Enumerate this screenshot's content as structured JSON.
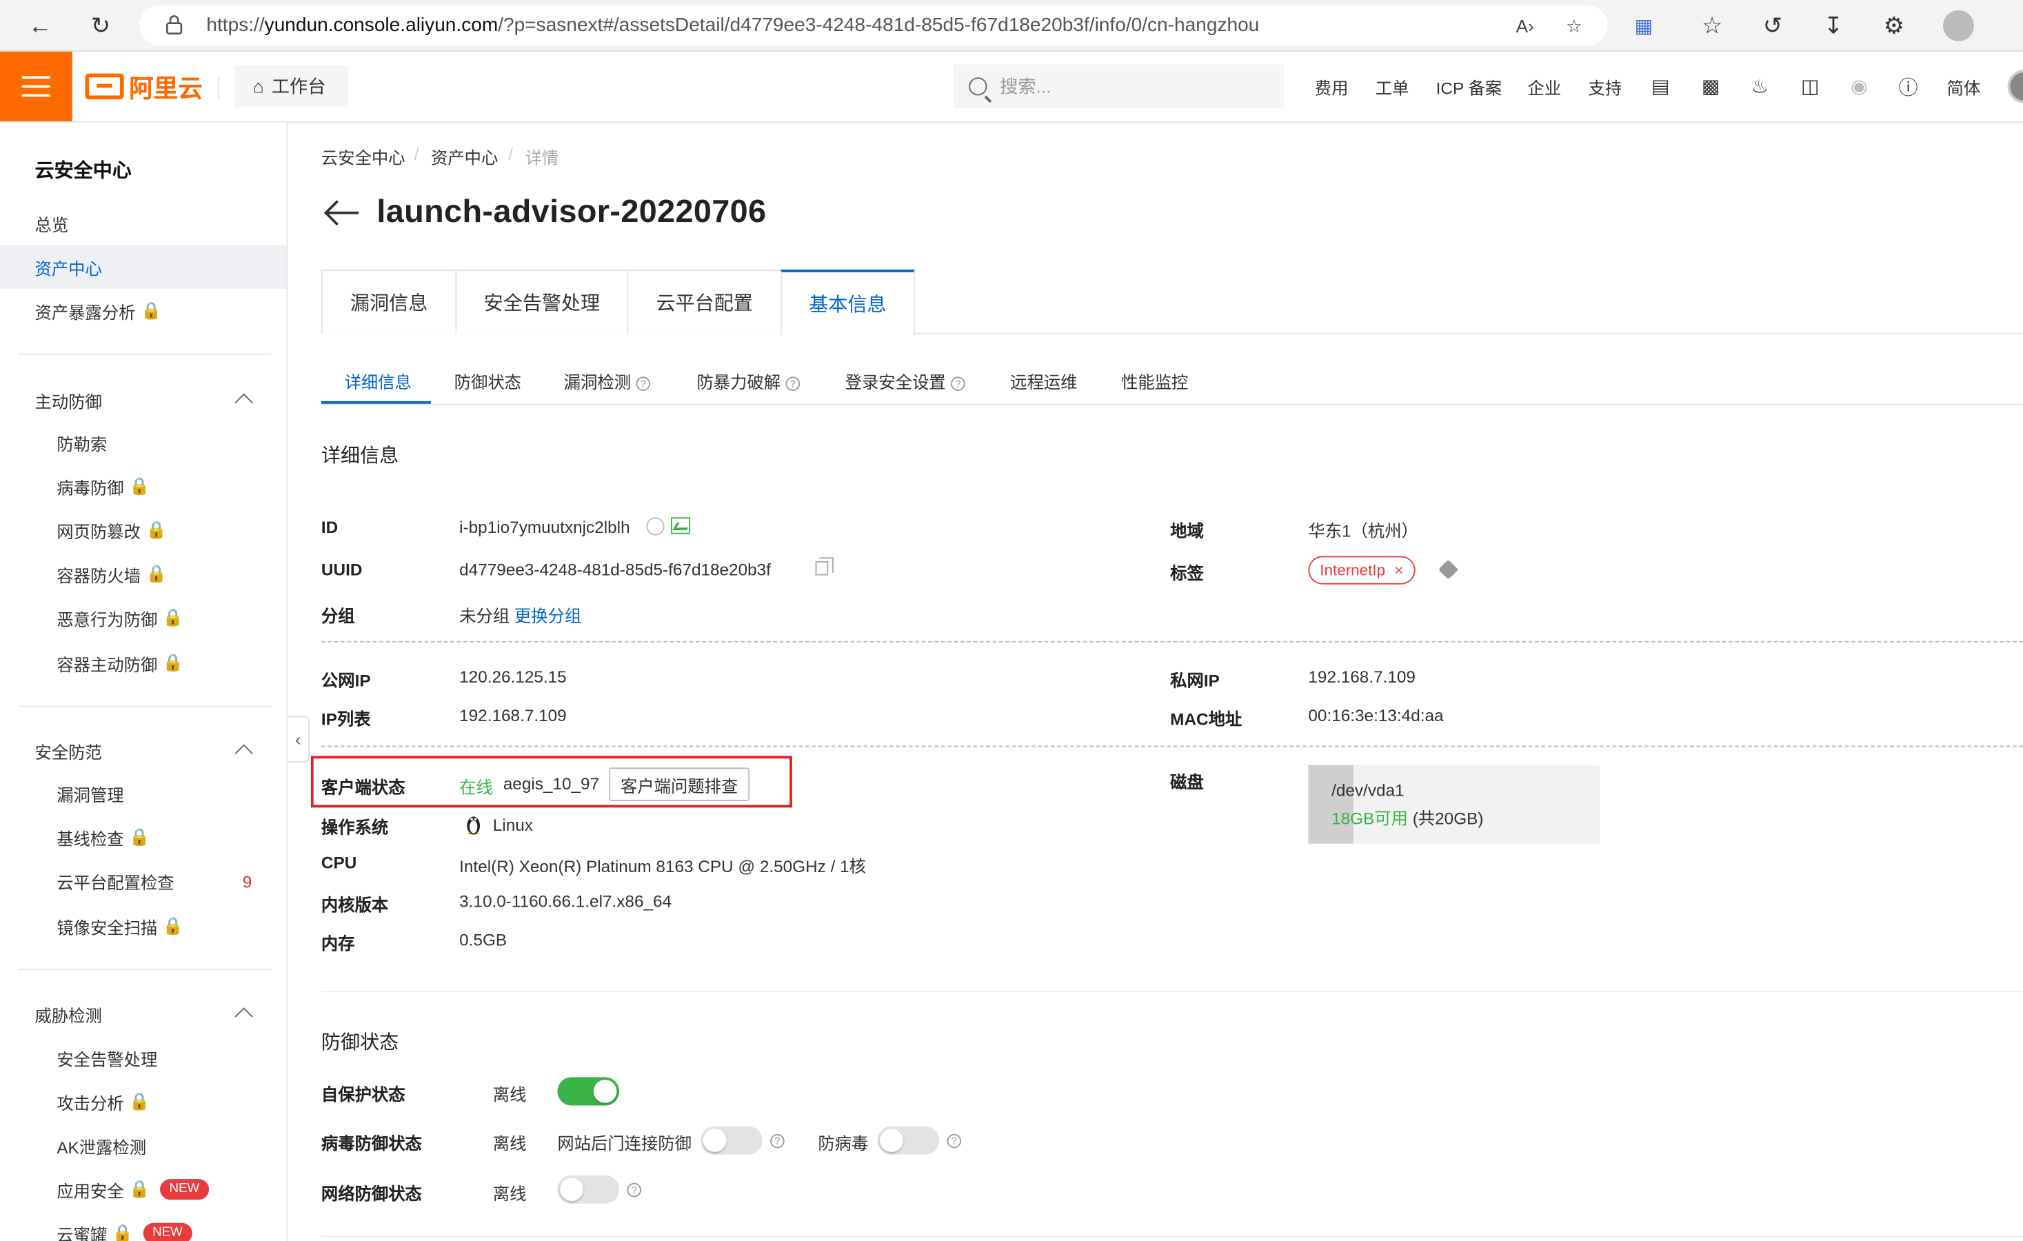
{
  "browser": {
    "url_prefix": "https://",
    "url_host": "yundun.console.aliyun.com",
    "url_path": "/?p=sasnext#/assetsDetail/d4779ee3-4248-481d-85d5-f67d18e20b3f/info/0/cn-hangzhou"
  },
  "topbar": {
    "logo_text": "阿里云",
    "workbench": "工作台",
    "search_placeholder": "搜索...",
    "nav": [
      "费用",
      "工单",
      "ICP 备案",
      "企业",
      "支持"
    ],
    "lang": "简体"
  },
  "sidebar": {
    "title": "云安全中心",
    "items_top": [
      {
        "label": "总览"
      },
      {
        "label": "资产中心",
        "active": true
      },
      {
        "label": "资产暴露分析",
        "locked": true
      }
    ],
    "groups": [
      {
        "title": "主动防御",
        "items": [
          {
            "label": "防勒索"
          },
          {
            "label": "病毒防御",
            "locked": true
          },
          {
            "label": "网页防篡改",
            "locked": true
          },
          {
            "label": "容器防火墙",
            "locked": true
          },
          {
            "label": "恶意行为防御",
            "locked": true
          },
          {
            "label": "容器主动防御",
            "locked": true
          }
        ]
      },
      {
        "title": "安全防范",
        "items": [
          {
            "label": "漏洞管理"
          },
          {
            "label": "基线检查",
            "locked": true
          },
          {
            "label": "云平台配置检查",
            "count": "9"
          },
          {
            "label": "镜像安全扫描",
            "locked": true
          }
        ]
      },
      {
        "title": "威胁检测",
        "items": [
          {
            "label": "安全告警处理"
          },
          {
            "label": "攻击分析",
            "locked": true
          },
          {
            "label": "AK泄露检测"
          },
          {
            "label": "应用安全",
            "locked": true,
            "badge": "NEW"
          },
          {
            "label": "云蜜罐",
            "locked": true,
            "badge": "NEW"
          }
        ]
      }
    ]
  },
  "breadcrumb": [
    "云安全中心",
    "资产中心",
    "详情"
  ],
  "page_title": "launch-advisor-20220706",
  "main_tabs": [
    "漏洞信息",
    "安全告警处理",
    "云平台配置",
    "基本信息"
  ],
  "sub_tabs": [
    "详细信息",
    "防御状态",
    "漏洞检测",
    "防暴力破解",
    "登录安全设置",
    "远程运维",
    "性能监控"
  ],
  "detail": {
    "section_title": "详细信息",
    "id_label": "ID",
    "id_value": "i-bp1io7ymuutxnjc2lblh",
    "uuid_label": "UUID",
    "uuid_value": "d4779ee3-4248-481d-85d5-f67d18e20b3f",
    "group_label": "分组",
    "group_value": "未分组",
    "group_link": "更换分组",
    "region_label": "地域",
    "region_value": "华东1（杭州）",
    "tag_label": "标签",
    "tag_value": "InternetIp",
    "public_ip_label": "公网IP",
    "public_ip_value": "120.26.125.15",
    "ip_list_label": "IP列表",
    "ip_list_value": "192.168.7.109",
    "private_ip_label": "私网IP",
    "private_ip_value": "192.168.7.109",
    "mac_label": "MAC地址",
    "mac_value": "00:16:3e:13:4d:aa",
    "client_label": "客户端状态",
    "client_status": "在线",
    "client_version": "aegis_10_97",
    "client_btn": "客户端问题排查",
    "os_label": "操作系统",
    "os_value": "Linux",
    "cpu_label": "CPU",
    "cpu_value": "Intel(R) Xeon(R) Platinum 8163 CPU @ 2.50GHz / 1核",
    "kernel_label": "内核版本",
    "kernel_value": "3.10.0-1160.66.1.el7.x86_64",
    "mem_label": "内存",
    "mem_value": "0.5GB",
    "disk_label": "磁盘",
    "disk_name": "/dev/vda1",
    "disk_free": "18GB可用",
    "disk_total": " (共20GB)",
    "disk_used_fraction": 0.1
  },
  "defense": {
    "section_title": "防御状态",
    "self_protect_label": "自保护状态",
    "self_protect_status": "离线",
    "self_protect_on": true,
    "virus_label": "病毒防御状态",
    "virus_status": "离线",
    "backdoor_label": "网站后门连接防御",
    "backdoor_on": false,
    "antivirus_label": "防病毒",
    "antivirus_on": false,
    "network_label": "网络防御状态",
    "network_status": "离线",
    "network_on": false
  }
}
